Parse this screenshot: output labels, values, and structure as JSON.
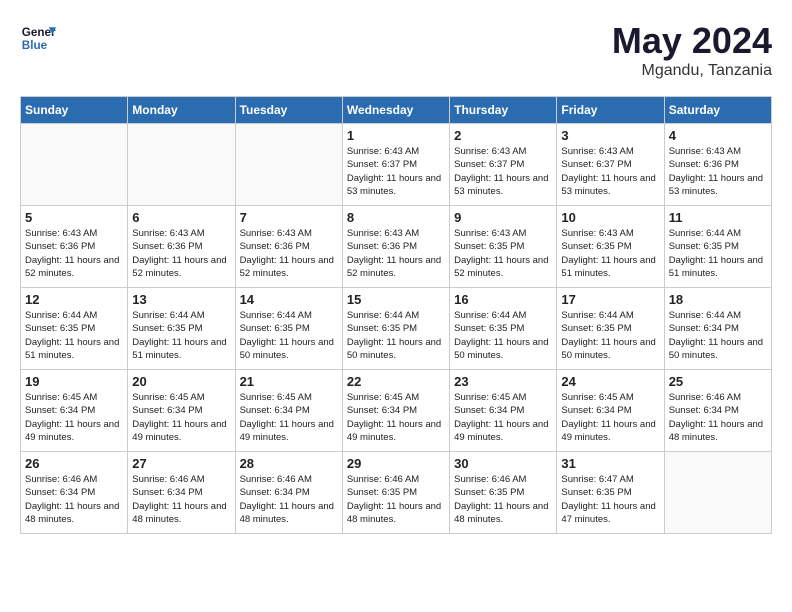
{
  "header": {
    "logo_line1": "General",
    "logo_line2": "Blue",
    "month_year": "May 2024",
    "location": "Mgandu, Tanzania"
  },
  "days_of_week": [
    "Sunday",
    "Monday",
    "Tuesday",
    "Wednesday",
    "Thursday",
    "Friday",
    "Saturday"
  ],
  "weeks": [
    [
      {
        "day": "",
        "empty": true
      },
      {
        "day": "",
        "empty": true
      },
      {
        "day": "",
        "empty": true
      },
      {
        "day": "1",
        "sunrise": "6:43 AM",
        "sunset": "6:37 PM",
        "daylight": "11 hours and 53 minutes."
      },
      {
        "day": "2",
        "sunrise": "6:43 AM",
        "sunset": "6:37 PM",
        "daylight": "11 hours and 53 minutes."
      },
      {
        "day": "3",
        "sunrise": "6:43 AM",
        "sunset": "6:37 PM",
        "daylight": "11 hours and 53 minutes."
      },
      {
        "day": "4",
        "sunrise": "6:43 AM",
        "sunset": "6:36 PM",
        "daylight": "11 hours and 53 minutes."
      }
    ],
    [
      {
        "day": "5",
        "sunrise": "6:43 AM",
        "sunset": "6:36 PM",
        "daylight": "11 hours and 52 minutes."
      },
      {
        "day": "6",
        "sunrise": "6:43 AM",
        "sunset": "6:36 PM",
        "daylight": "11 hours and 52 minutes."
      },
      {
        "day": "7",
        "sunrise": "6:43 AM",
        "sunset": "6:36 PM",
        "daylight": "11 hours and 52 minutes."
      },
      {
        "day": "8",
        "sunrise": "6:43 AM",
        "sunset": "6:36 PM",
        "daylight": "11 hours and 52 minutes."
      },
      {
        "day": "9",
        "sunrise": "6:43 AM",
        "sunset": "6:35 PM",
        "daylight": "11 hours and 52 minutes."
      },
      {
        "day": "10",
        "sunrise": "6:43 AM",
        "sunset": "6:35 PM",
        "daylight": "11 hours and 51 minutes."
      },
      {
        "day": "11",
        "sunrise": "6:44 AM",
        "sunset": "6:35 PM",
        "daylight": "11 hours and 51 minutes."
      }
    ],
    [
      {
        "day": "12",
        "sunrise": "6:44 AM",
        "sunset": "6:35 PM",
        "daylight": "11 hours and 51 minutes."
      },
      {
        "day": "13",
        "sunrise": "6:44 AM",
        "sunset": "6:35 PM",
        "daylight": "11 hours and 51 minutes."
      },
      {
        "day": "14",
        "sunrise": "6:44 AM",
        "sunset": "6:35 PM",
        "daylight": "11 hours and 50 minutes."
      },
      {
        "day": "15",
        "sunrise": "6:44 AM",
        "sunset": "6:35 PM",
        "daylight": "11 hours and 50 minutes."
      },
      {
        "day": "16",
        "sunrise": "6:44 AM",
        "sunset": "6:35 PM",
        "daylight": "11 hours and 50 minutes."
      },
      {
        "day": "17",
        "sunrise": "6:44 AM",
        "sunset": "6:35 PM",
        "daylight": "11 hours and 50 minutes."
      },
      {
        "day": "18",
        "sunrise": "6:44 AM",
        "sunset": "6:34 PM",
        "daylight": "11 hours and 50 minutes."
      }
    ],
    [
      {
        "day": "19",
        "sunrise": "6:45 AM",
        "sunset": "6:34 PM",
        "daylight": "11 hours and 49 minutes."
      },
      {
        "day": "20",
        "sunrise": "6:45 AM",
        "sunset": "6:34 PM",
        "daylight": "11 hours and 49 minutes."
      },
      {
        "day": "21",
        "sunrise": "6:45 AM",
        "sunset": "6:34 PM",
        "daylight": "11 hours and 49 minutes."
      },
      {
        "day": "22",
        "sunrise": "6:45 AM",
        "sunset": "6:34 PM",
        "daylight": "11 hours and 49 minutes."
      },
      {
        "day": "23",
        "sunrise": "6:45 AM",
        "sunset": "6:34 PM",
        "daylight": "11 hours and 49 minutes."
      },
      {
        "day": "24",
        "sunrise": "6:45 AM",
        "sunset": "6:34 PM",
        "daylight": "11 hours and 49 minutes."
      },
      {
        "day": "25",
        "sunrise": "6:46 AM",
        "sunset": "6:34 PM",
        "daylight": "11 hours and 48 minutes."
      }
    ],
    [
      {
        "day": "26",
        "sunrise": "6:46 AM",
        "sunset": "6:34 PM",
        "daylight": "11 hours and 48 minutes."
      },
      {
        "day": "27",
        "sunrise": "6:46 AM",
        "sunset": "6:34 PM",
        "daylight": "11 hours and 48 minutes."
      },
      {
        "day": "28",
        "sunrise": "6:46 AM",
        "sunset": "6:34 PM",
        "daylight": "11 hours and 48 minutes."
      },
      {
        "day": "29",
        "sunrise": "6:46 AM",
        "sunset": "6:35 PM",
        "daylight": "11 hours and 48 minutes."
      },
      {
        "day": "30",
        "sunrise": "6:46 AM",
        "sunset": "6:35 PM",
        "daylight": "11 hours and 48 minutes."
      },
      {
        "day": "31",
        "sunrise": "6:47 AM",
        "sunset": "6:35 PM",
        "daylight": "11 hours and 47 minutes."
      },
      {
        "day": "",
        "empty": true
      }
    ]
  ]
}
